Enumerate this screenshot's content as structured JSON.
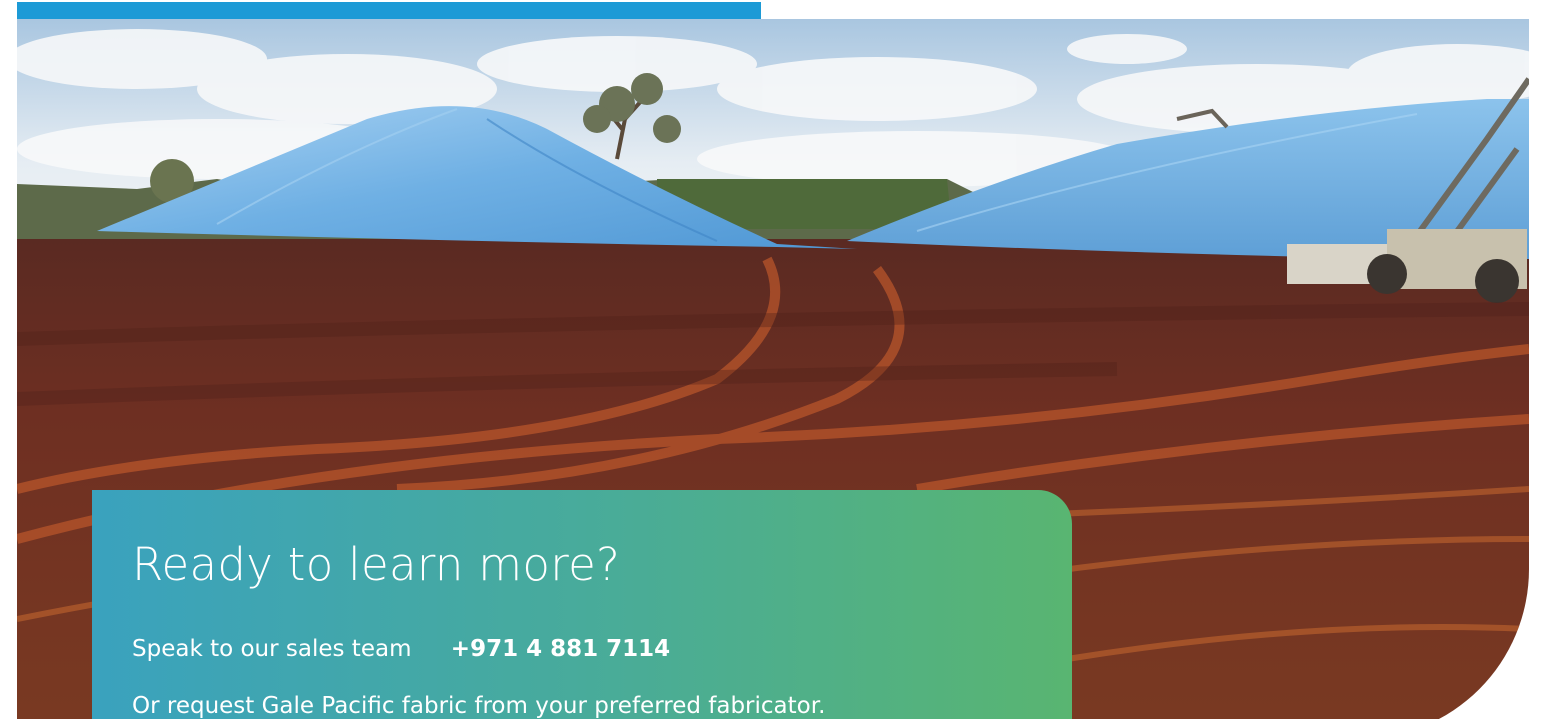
{
  "cta": {
    "title": "Ready to learn more?",
    "sales_label": "Speak to our sales team",
    "phone": "+971 4 881 7114",
    "fabricator_text": "Or request Gale Pacific fabric from your preferred fabricator."
  },
  "colors": {
    "top_bar": "#1c9ad6",
    "gradient_start": "#3aa2be",
    "gradient_end": "#59b571",
    "tarp_blue": "#7fbbe6",
    "ground": "#6b2d22"
  }
}
